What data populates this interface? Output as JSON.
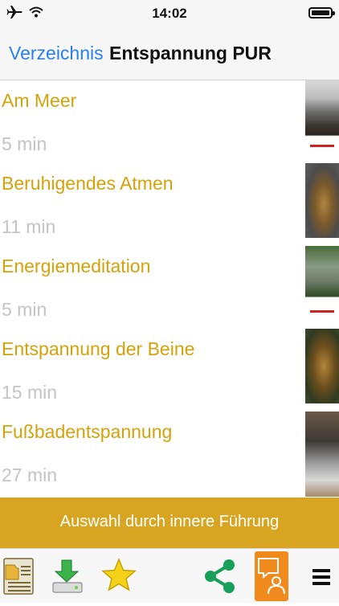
{
  "status_bar": {
    "time": "14:02",
    "icons": [
      "airplane-icon",
      "wifi-icon",
      "battery-icon"
    ]
  },
  "nav": {
    "back_label": "Verzeichnis",
    "title": "Entspannung PUR"
  },
  "items": [
    {
      "title": "Am Meer",
      "duration": "5 min",
      "thumbnail": "sea-thumbnail"
    },
    {
      "title": "Beruhigendes Atmen",
      "duration": "11 min",
      "thumbnail": "buddha-thumbnail"
    },
    {
      "title": "Energiemeditation",
      "duration": "5 min",
      "thumbnail": "meditation-statue-thumbnail"
    },
    {
      "title": "Entspannung der Beine",
      "duration": "15 min",
      "thumbnail": "golden-statue-thumbnail"
    },
    {
      "title": "Fußbadentspannung",
      "duration": "27 min",
      "thumbnail": "footbath-thumbnail"
    }
  ],
  "banner": {
    "label": "Auswahl durch innere Führung"
  },
  "toolbar": {
    "icons": [
      "folder-list-icon",
      "download-icon",
      "star-icon",
      "share-icon",
      "profile-chat-icon",
      "menu-icon"
    ]
  },
  "colors": {
    "accent_gold": "#d4a20a",
    "banner_gold": "#d8a522",
    "link_blue": "#2a7ff2",
    "duration_gray": "#c4c4c4",
    "share_green": "#17a05a",
    "active_orange": "#f08a1c"
  }
}
